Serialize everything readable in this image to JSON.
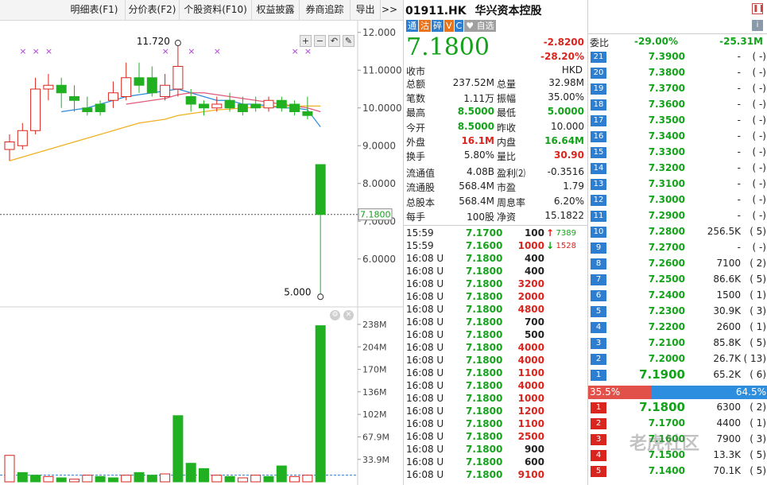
{
  "tabs": [
    {
      "label": "明细表(F1)"
    },
    {
      "label": "分价表(F2)"
    },
    {
      "label": "个股资料(F10)"
    },
    {
      "label": "权益披露"
    },
    {
      "label": "券商追踪"
    },
    {
      "label": "导出"
    },
    {
      "label": ">>"
    }
  ],
  "chart_tools": [
    "+",
    "−",
    "↶",
    "✎"
  ],
  "volume_tools": [
    "gear-icon",
    "close-icon"
  ],
  "chart_data": [
    {
      "type": "candlestick",
      "y_ticks": [
        "12.000",
        "11.0000",
        "10.0000",
        "9.0000",
        "8.0000",
        "7.0000",
        "6.0000"
      ],
      "ylim": [
        4.9,
        12.1
      ],
      "current_price_label": "7.1800",
      "high_label": "11.720",
      "low_label": "5.000",
      "candles": [
        {
          "o": 8.9,
          "c": 9.1,
          "h": 9.3,
          "l": 8.6
        },
        {
          "o": 9.0,
          "c": 9.4,
          "h": 9.6,
          "l": 8.9
        },
        {
          "o": 9.4,
          "c": 10.5,
          "h": 10.8,
          "l": 9.3
        },
        {
          "o": 10.5,
          "c": 10.6,
          "h": 10.9,
          "l": 10.2
        },
        {
          "o": 10.6,
          "c": 10.4,
          "h": 10.8,
          "l": 10.0
        },
        {
          "o": 10.3,
          "c": 10.2,
          "h": 10.6,
          "l": 9.9
        },
        {
          "o": 10.0,
          "c": 9.9,
          "h": 10.3,
          "l": 9.8
        },
        {
          "o": 10.1,
          "c": 9.9,
          "h": 10.2,
          "l": 9.8
        },
        {
          "o": 10.2,
          "c": 10.4,
          "h": 10.7,
          "l": 10.0
        },
        {
          "o": 10.3,
          "c": 10.8,
          "h": 11.2,
          "l": 10.2
        },
        {
          "o": 10.8,
          "c": 10.6,
          "h": 11.2,
          "l": 10.4
        },
        {
          "o": 10.8,
          "c": 10.4,
          "h": 11.1,
          "l": 10.3
        },
        {
          "o": 10.3,
          "c": 10.6,
          "h": 10.9,
          "l": 10.2
        },
        {
          "o": 10.5,
          "c": 11.1,
          "h": 11.72,
          "l": 10.3
        },
        {
          "o": 10.3,
          "c": 10.1,
          "h": 10.5,
          "l": 9.9
        },
        {
          "o": 10.1,
          "c": 10.0,
          "h": 10.2,
          "l": 9.8
        },
        {
          "o": 10.0,
          "c": 10.1,
          "h": 10.3,
          "l": 9.9
        },
        {
          "o": 10.2,
          "c": 10.0,
          "h": 10.4,
          "l": 9.9
        },
        {
          "o": 10.1,
          "c": 9.9,
          "h": 10.3,
          "l": 9.8
        },
        {
          "o": 10.1,
          "c": 10.0,
          "h": 10.3,
          "l": 9.9
        },
        {
          "o": 10.0,
          "c": 10.2,
          "h": 10.3,
          "l": 9.9
        },
        {
          "o": 10.2,
          "c": 10.0,
          "h": 10.3,
          "l": 9.9
        },
        {
          "o": 10.1,
          "c": 9.9,
          "h": 10.2,
          "l": 9.8
        },
        {
          "o": 9.9,
          "c": 9.8,
          "h": 10.3,
          "l": 9.7
        },
        {
          "o": 8.5,
          "c": 7.18,
          "h": 8.5,
          "l": 5.0
        }
      ],
      "ma_series": [
        {
          "color": "#2b8ad9",
          "values": [
            null,
            null,
            null,
            null,
            9.9,
            9.95,
            10.0,
            10.1,
            10.2,
            10.3,
            10.35,
            10.4,
            10.45,
            10.5,
            10.4,
            10.3,
            10.2,
            10.2,
            10.1,
            10.1,
            10.05,
            10.0,
            10.0,
            9.95,
            9.5
          ]
        },
        {
          "color": "#e05a7a",
          "values": [
            null,
            null,
            null,
            null,
            null,
            null,
            null,
            null,
            null,
            10.1,
            10.15,
            10.2,
            10.25,
            10.35,
            10.4,
            10.4,
            10.35,
            10.3,
            10.25,
            10.2,
            10.15,
            10.1,
            10.05,
            10.0,
            9.9
          ]
        },
        {
          "color": "#f0b020",
          "values": [
            8.6,
            8.7,
            8.8,
            8.9,
            9.0,
            9.1,
            9.2,
            9.3,
            9.4,
            9.5,
            9.6,
            9.65,
            9.7,
            9.8,
            9.85,
            9.9,
            9.95,
            9.97,
            10.0,
            10.02,
            10.04,
            10.05,
            10.05,
            10.05,
            10.05
          ]
        }
      ],
      "markers_x": [
        1,
        2,
        3,
        12,
        14,
        16,
        22,
        23
      ]
    },
    {
      "type": "bar",
      "y_ticks": [
        "238M",
        "204M",
        "170M",
        "136M",
        "102M",
        "67.9M",
        "33.9M"
      ],
      "ylim": [
        0,
        250
      ],
      "values": [
        40,
        14,
        10,
        8,
        6,
        4,
        10,
        8,
        6,
        10,
        14,
        10,
        12,
        100,
        28,
        20,
        10,
        8,
        6,
        10,
        8,
        24,
        8,
        10,
        236
      ],
      "colors": [
        "r",
        "g",
        "g",
        "r",
        "g",
        "r",
        "r",
        "g",
        "g",
        "r",
        "g",
        "g",
        "r",
        "g",
        "g",
        "g",
        "r",
        "g",
        "r",
        "r",
        "g",
        "g",
        "r",
        "r",
        "g"
      ]
    }
  ],
  "quote": {
    "symbol": "01911.HK",
    "name": "华兴资本控股",
    "badges": [
      {
        "text": "通",
        "color": "#2d7ed1"
      },
      {
        "text": "沽",
        "color": "#e8731b"
      },
      {
        "text": "碎",
        "color": "#2d7ed1"
      },
      {
        "text": "V",
        "color": "#e8731b"
      },
      {
        "text": "C",
        "color": "#2d7ed1"
      },
      {
        "text": "♥ 自选",
        "color": "#a0a0a0"
      }
    ],
    "price": "7.1800",
    "change": "-2.8200",
    "change_pct": "-28.20%",
    "close_label": "收市",
    "currency": "HKD",
    "stats": [
      {
        "label": "总额",
        "value": "237.52M",
        "label2": "总量",
        "value2": "32.98M",
        "c1": "#222",
        "c2": "#222"
      },
      {
        "label": "笔数",
        "value": "1.11万",
        "label2": "振幅",
        "value2": "35.00%",
        "c1": "#222",
        "c2": "#222"
      },
      {
        "label": "最高",
        "value": "8.5000",
        "label2": "最低",
        "value2": "5.0000",
        "c1": "#15a21b",
        "c2": "#15a21b"
      },
      {
        "label": "今开",
        "value": "8.5000",
        "label2": "昨收",
        "value2": "10.000",
        "c1": "#15a21b",
        "c2": "#222"
      },
      {
        "label": "外盘",
        "value": "16.1M",
        "label2": "内盘",
        "value2": "16.64M",
        "c1": "#d9251d",
        "c2": "#15a21b"
      },
      {
        "label": "换手",
        "value": "5.80%",
        "label2": "量比",
        "value2": "30.90",
        "c1": "#222",
        "c2": "#d9251d"
      },
      {
        "label": "流通值",
        "value": "4.08B",
        "label2": "盈利⑵",
        "value2": "-0.3516",
        "c1": "#222",
        "c2": "#222"
      },
      {
        "label": "流通股",
        "value": "568.4M",
        "label2": "市盈",
        "value2": "1.79",
        "c1": "#222",
        "c2": "#222"
      },
      {
        "label": "总股本",
        "value": "568.4M",
        "label2": "周息率",
        "value2": "6.20%",
        "c1": "#222",
        "c2": "#222"
      },
      {
        "label": "每手",
        "value": "100股",
        "label2": "净资",
        "value2": "15.1822",
        "c1": "#222",
        "c2": "#222"
      }
    ],
    "ticks": [
      {
        "time": "15:59",
        "price": "7.1700",
        "vol": "100",
        "dir": "up",
        "extra": "7389"
      },
      {
        "time": "15:59",
        "price": "7.1600",
        "vol": "1000",
        "dir": "down",
        "extra": "1528"
      },
      {
        "time": "16:08 U",
        "price": "7.1800",
        "vol": "400"
      },
      {
        "time": "16:08 U",
        "price": "7.1800",
        "vol": "400"
      },
      {
        "time": "16:08 U",
        "price": "7.1800",
        "vol": "3200"
      },
      {
        "time": "16:08 U",
        "price": "7.1800",
        "vol": "2000"
      },
      {
        "time": "16:08 U",
        "price": "7.1800",
        "vol": "4800"
      },
      {
        "time": "16:08 U",
        "price": "7.1800",
        "vol": "700"
      },
      {
        "time": "16:08 U",
        "price": "7.1800",
        "vol": "500"
      },
      {
        "time": "16:08 U",
        "price": "7.1800",
        "vol": "4000"
      },
      {
        "time": "16:08 U",
        "price": "7.1800",
        "vol": "4000"
      },
      {
        "time": "16:08 U",
        "price": "7.1800",
        "vol": "1100"
      },
      {
        "time": "16:08 U",
        "price": "7.1800",
        "vol": "4000"
      },
      {
        "time": "16:08 U",
        "price": "7.1800",
        "vol": "1000"
      },
      {
        "time": "16:08 U",
        "price": "7.1800",
        "vol": "1200"
      },
      {
        "time": "16:08 U",
        "price": "7.1800",
        "vol": "1100"
      },
      {
        "time": "16:08 U",
        "price": "7.1800",
        "vol": "2500"
      },
      {
        "time": "16:08 U",
        "price": "7.1800",
        "vol": "900"
      },
      {
        "time": "16:08 U",
        "price": "7.1800",
        "vol": "600"
      },
      {
        "time": "16:08 U",
        "price": "7.1800",
        "vol": "9100"
      }
    ]
  },
  "book": {
    "header_label": "委比",
    "header_pct": "-29.00%",
    "header_diff": "-25.31M",
    "asks": [
      {
        "lvl": "21",
        "price": "7.3900",
        "vol": "-",
        "cnt": "( -)"
      },
      {
        "lvl": "20",
        "price": "7.3800",
        "vol": "-",
        "cnt": "( -)"
      },
      {
        "lvl": "19",
        "price": "7.3700",
        "vol": "-",
        "cnt": "( -)"
      },
      {
        "lvl": "18",
        "price": "7.3600",
        "vol": "-",
        "cnt": "( -)"
      },
      {
        "lvl": "17",
        "price": "7.3500",
        "vol": "-",
        "cnt": "( -)"
      },
      {
        "lvl": "16",
        "price": "7.3400",
        "vol": "-",
        "cnt": "( -)"
      },
      {
        "lvl": "15",
        "price": "7.3300",
        "vol": "-",
        "cnt": "( -)"
      },
      {
        "lvl": "14",
        "price": "7.3200",
        "vol": "-",
        "cnt": "( -)"
      },
      {
        "lvl": "13",
        "price": "7.3100",
        "vol": "-",
        "cnt": "( -)"
      },
      {
        "lvl": "12",
        "price": "7.3000",
        "vol": "-",
        "cnt": "( -)"
      },
      {
        "lvl": "11",
        "price": "7.2900",
        "vol": "-",
        "cnt": "( -)"
      },
      {
        "lvl": "10",
        "price": "7.2800",
        "vol": "256.5K",
        "cnt": "( 5)"
      },
      {
        "lvl": "9",
        "price": "7.2700",
        "vol": "-",
        "cnt": "( -)"
      },
      {
        "lvl": "8",
        "price": "7.2600",
        "vol": "7100",
        "cnt": "( 2)"
      },
      {
        "lvl": "7",
        "price": "7.2500",
        "vol": "86.6K",
        "cnt": "( 5)"
      },
      {
        "lvl": "6",
        "price": "7.2400",
        "vol": "1500",
        "cnt": "( 1)"
      },
      {
        "lvl": "5",
        "price": "7.2300",
        "vol": "30.9K",
        "cnt": "( 3)"
      },
      {
        "lvl": "4",
        "price": "7.2200",
        "vol": "2600",
        "cnt": "( 1)"
      },
      {
        "lvl": "3",
        "price": "7.2100",
        "vol": "85.8K",
        "cnt": "( 5)"
      },
      {
        "lvl": "2",
        "price": "7.2000",
        "vol": "26.7K",
        "cnt": "( 13)"
      },
      {
        "lvl": "1",
        "price": "7.1900",
        "vol": "65.2K",
        "cnt": "( 6)"
      }
    ],
    "ratio_left": "35.5%",
    "ratio_right": "64.5%",
    "ratio_left_fraction": 0.355,
    "bids": [
      {
        "lvl": "1",
        "price": "7.1800",
        "vol": "6300",
        "cnt": "( 2)"
      },
      {
        "lvl": "2",
        "price": "7.1700",
        "vol": "4400",
        "cnt": "( 1)"
      },
      {
        "lvl": "3",
        "price": "7.1600",
        "vol": "7900",
        "cnt": "( 3)"
      },
      {
        "lvl": "4",
        "price": "7.1500",
        "vol": "13.3K",
        "cnt": "( 5)"
      },
      {
        "lvl": "5",
        "price": "7.1400",
        "vol": "70.1K",
        "cnt": "( 5)"
      }
    ],
    "watermark": "老虎社区"
  }
}
